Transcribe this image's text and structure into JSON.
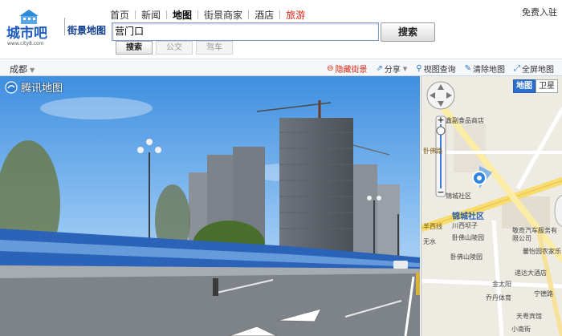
{
  "header": {
    "logo_text": "城市吧",
    "logo_url_text": "www.city8.com",
    "logo_sub": "街景地图",
    "nav": [
      "首页",
      "新闻",
      "地图",
      "街景商家",
      "酒店",
      "旅游"
    ],
    "login": "免费入驻",
    "search_value": "营门口",
    "search_button": "搜索",
    "modes": [
      "搜索",
      "公交",
      "驾车"
    ]
  },
  "toolbar": {
    "city": "成都",
    "tools": [
      "隐藏街景",
      "分享",
      "视图查询",
      "清除地图",
      "全屏地图"
    ]
  },
  "pano": {
    "brand": "腾讯地图"
  },
  "map": {
    "tabs": [
      "地图",
      "卫星"
    ],
    "labels": [
      "鑫副食品商店",
      "锦城社区",
      "锦城社区",
      "川西坝子",
      "卧佛山陵园",
      "敬奇汽车服务有限公司",
      "卧佛山陵园",
      "馨怡园农家乐",
      "递达大酒店",
      "金太阳",
      "乔丹体育",
      "宁德路",
      "天粤宾馆",
      "无水",
      "羊西线",
      "卧佛路",
      "小南街"
    ]
  },
  "colors": {
    "accent_red": "#d8240f",
    "brand_blue": "#0d3c8c",
    "map_road_yellow": "#f7dc6f"
  }
}
